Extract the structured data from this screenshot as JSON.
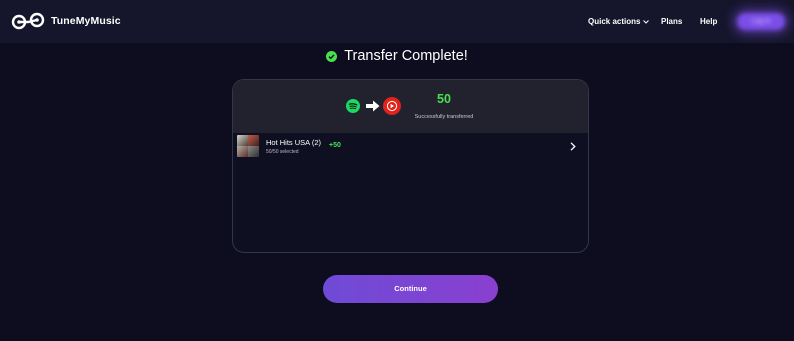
{
  "header": {
    "brand": "TuneMyMusic",
    "nav": {
      "quick_actions": "Quick actions",
      "plans": "Plans",
      "help": "Help"
    },
    "signin_label": "Log in"
  },
  "transfer": {
    "title": "Transfer Complete!",
    "count": "50",
    "count_label": "Successfully transferred",
    "source_icon": "spotify-icon",
    "destination_icon": "youtube-music-icon"
  },
  "playlists": [
    {
      "name": "Hot Hits USA (2)",
      "selected": "50/50 selected",
      "added": "+50"
    }
  ],
  "actions": {
    "continue_label": "Continue"
  },
  "colors": {
    "background": "#0d0d1f",
    "header": "#15152b",
    "accent": "#7b4ee8",
    "success": "#49e04f",
    "spotify": "#1ed760",
    "youtube_music": "#e3231b"
  }
}
